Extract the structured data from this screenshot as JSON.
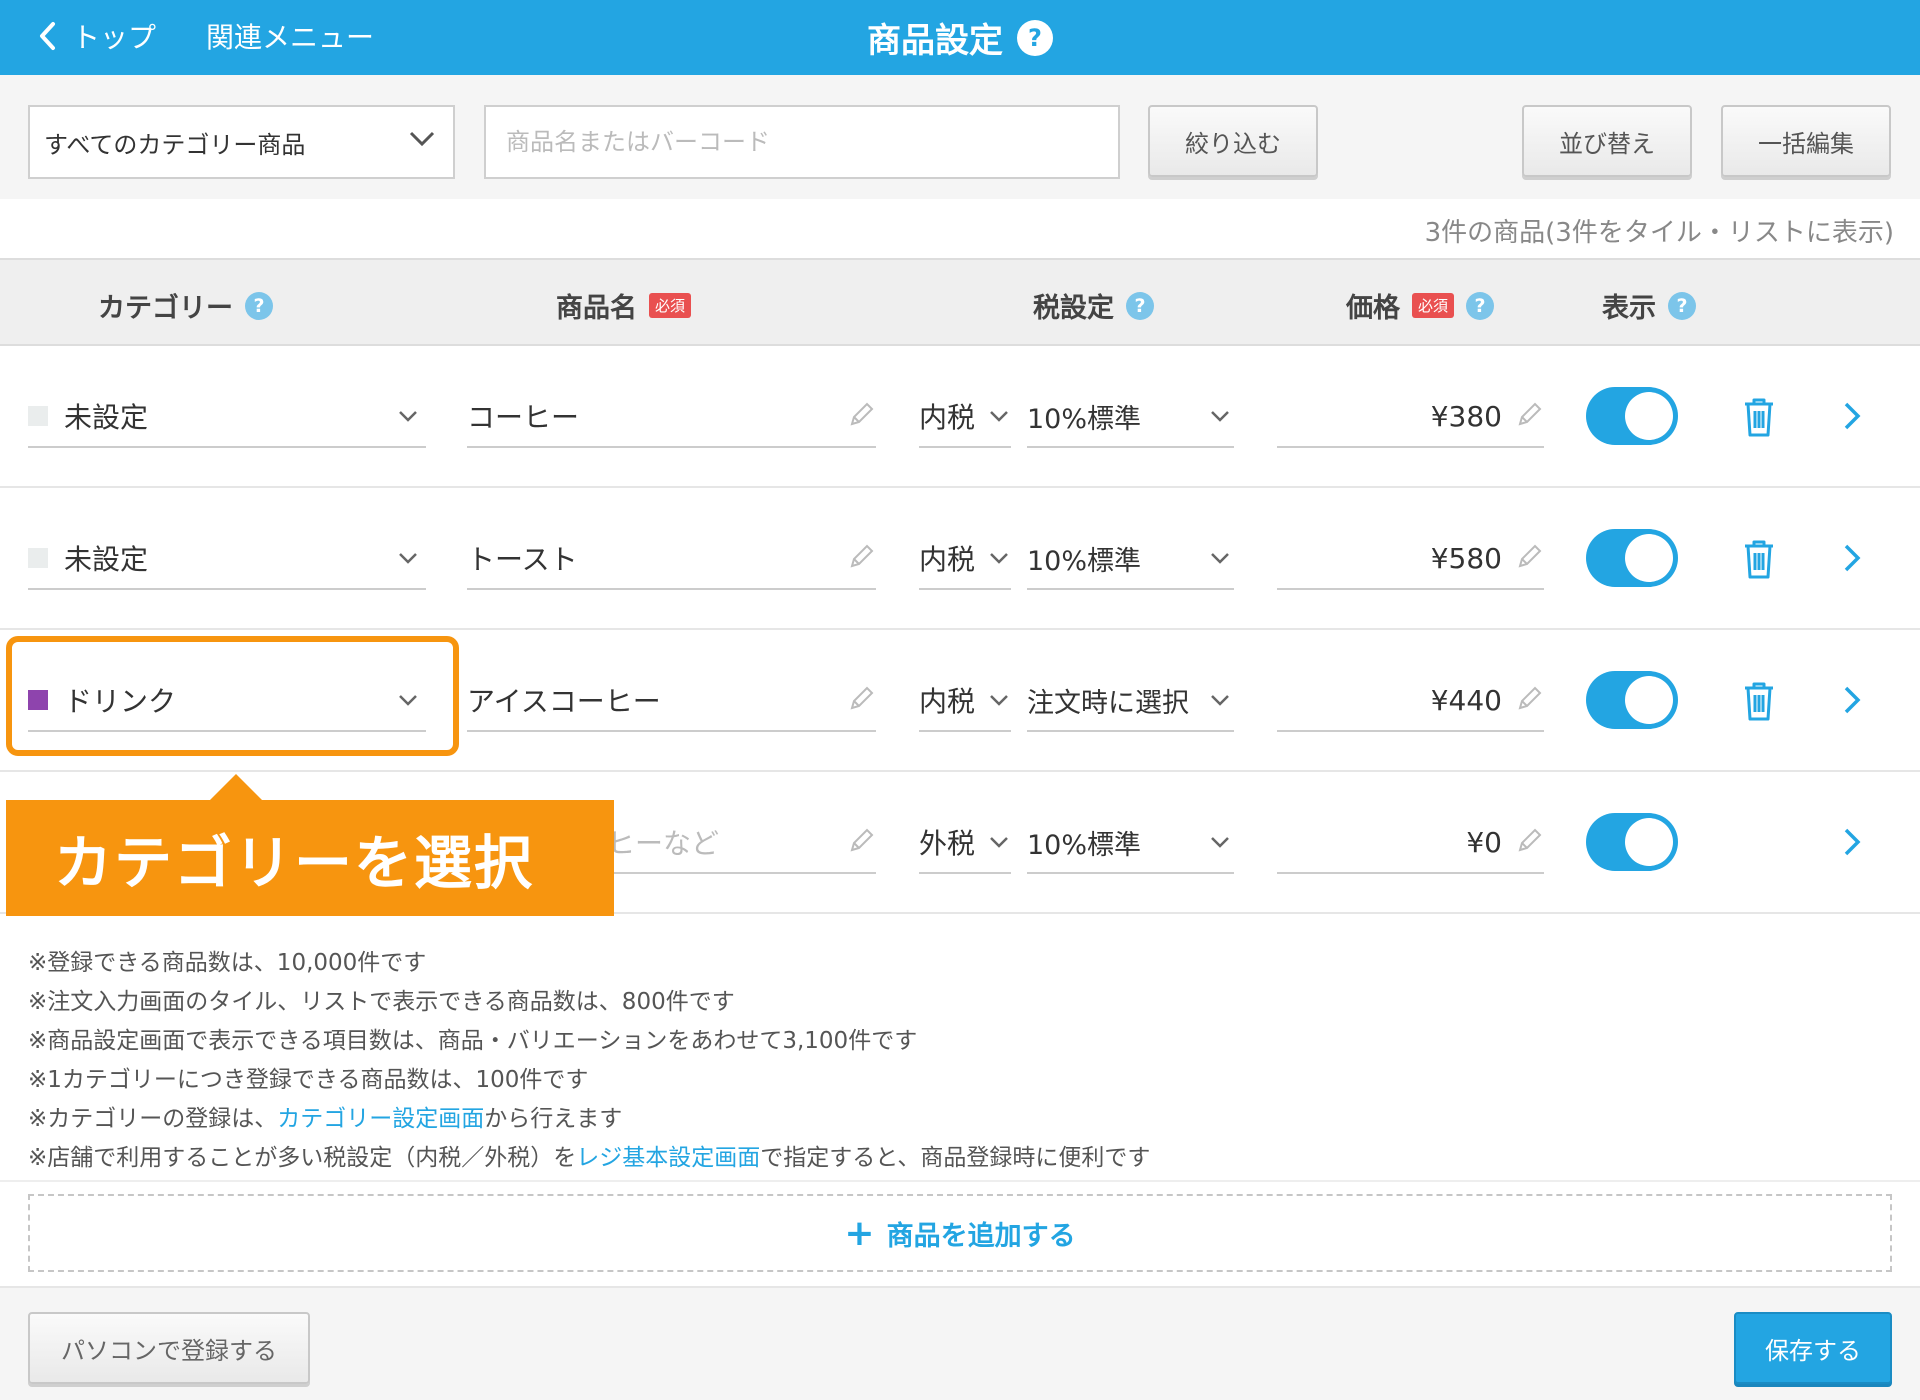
{
  "header": {
    "back_label": "トップ",
    "related_menu_label": "関連メニュー",
    "title": "商品設定",
    "help_label": "?"
  },
  "toolbar": {
    "category_select": "すべてのカテゴリー商品",
    "search_placeholder": "商品名またはバーコード",
    "filter_label": "絞り込む",
    "sort_label": "並び替え",
    "bulk_edit_label": "一括編集"
  },
  "summary": "3件の商品(3件をタイル・リストに表示)",
  "columns": {
    "category": "カテゴリー",
    "name": "商品名",
    "tax": "税設定",
    "price": "価格",
    "display": "表示",
    "required_badge": "必須",
    "help": "?"
  },
  "rows": [
    {
      "category": "未設定",
      "category_color": "#eaeded",
      "name": "コーヒー",
      "tax_type": "内税",
      "tax_rate": "10%標準",
      "price": "¥380",
      "display_on": true,
      "deletable": true
    },
    {
      "category": "未設定",
      "category_color": "#eaeded",
      "name": "トースト",
      "tax_type": "内税",
      "tax_rate": "10%標準",
      "price": "¥580",
      "display_on": true,
      "deletable": true
    },
    {
      "category": "ドリンク",
      "category_color": "#8e44ad",
      "name": "アイスコーヒー",
      "tax_type": "内税",
      "tax_rate": "注文時に選択",
      "price": "¥440",
      "display_on": true,
      "deletable": true
    },
    {
      "category": "",
      "category_color": "#eaeded",
      "name": "",
      "name_placeholder": "ヒーなど",
      "tax_type": "外税",
      "tax_rate": "10%標準",
      "price": "¥0",
      "display_on": true,
      "deletable": false
    }
  ],
  "callout": "カテゴリーを選択",
  "notes": {
    "line1": "※登録できる商品数は、10,000件です",
    "line2": "※注文入力画面のタイル、リストで表示できる商品数は、800件です",
    "line3": "※商品設定画面で表示できる項目数は、商品・バリエーションをあわせて3,100件です",
    "line4": "※1カテゴリーにつき登録できる商品数は、100件です",
    "line5_pre": "※カテゴリーの登録は、",
    "line5_link": "カテゴリー設定画面",
    "line5_post": "から行えます",
    "line6_pre": "※店舗で利用することが多い税設定（内税／外税）を",
    "line6_link": "レジ基本設定画面",
    "line6_post": "で指定すると、商品登録時に便利です"
  },
  "add_product_label": "商品を追加する",
  "footer": {
    "pc_register_label": "パソコンで登録する",
    "save_label": "保存する"
  },
  "colors": {
    "accent": "#23a5e2",
    "highlight": "#f7950f",
    "required": "#e95050"
  }
}
